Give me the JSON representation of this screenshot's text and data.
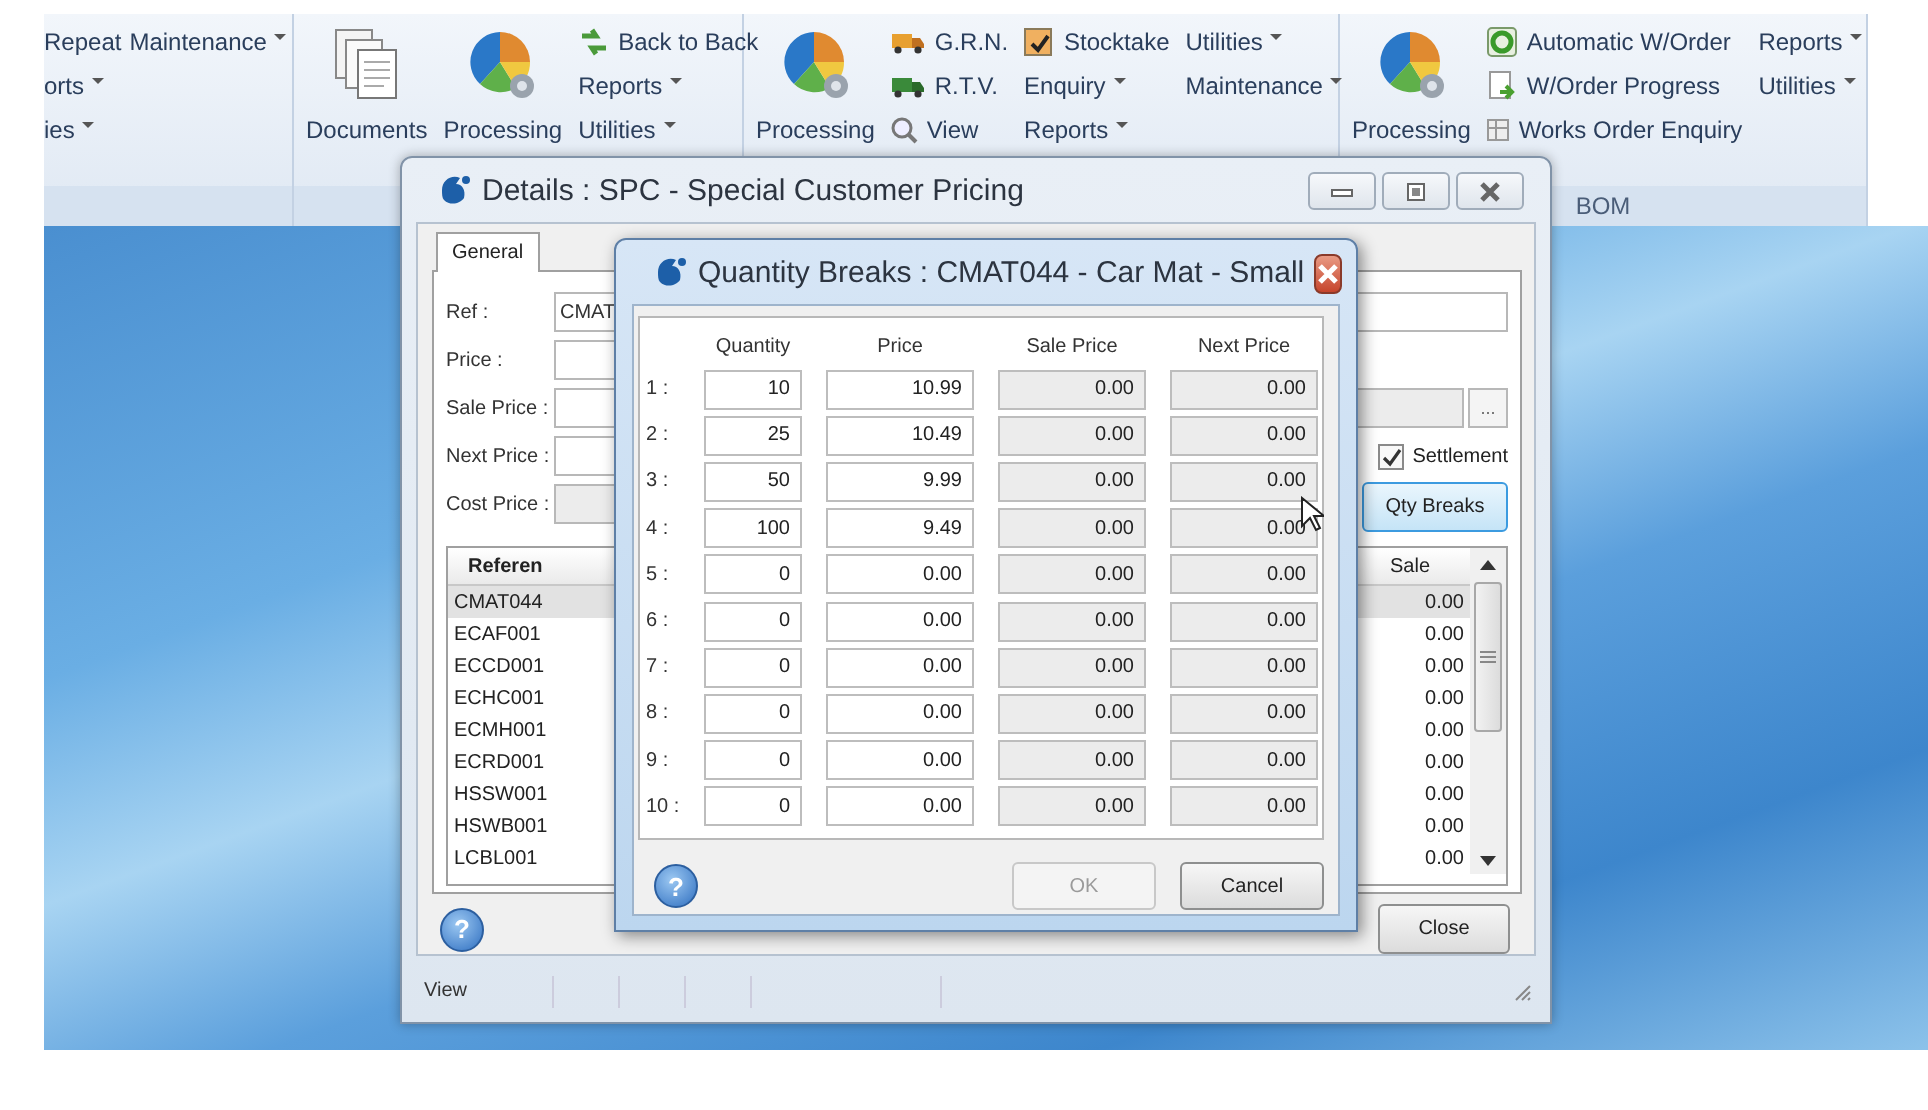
{
  "ribbon": {
    "groups": [
      {
        "columns": [
          [
            {
              "kind": "text",
              "label": "Repeat"
            },
            {
              "kind": "menu",
              "label": "orts"
            },
            {
              "kind": "menu",
              "label": "ies"
            }
          ],
          [
            {
              "kind": "menu",
              "label": "Maintenance"
            }
          ]
        ]
      },
      {
        "columns": [
          [
            {
              "kind": "large",
              "label": "Documents"
            }
          ],
          [
            {
              "kind": "large",
              "label": "Processing"
            }
          ],
          [
            {
              "kind": "small",
              "label": "Back to Back"
            },
            {
              "kind": "menu",
              "label": "Reports"
            },
            {
              "kind": "menu",
              "label": "Utilities"
            }
          ]
        ]
      },
      {
        "columns": [
          [
            {
              "kind": "large",
              "label": "Processing"
            }
          ],
          [
            {
              "kind": "small",
              "label": "G.R.N."
            },
            {
              "kind": "small",
              "label": "R.T.V."
            },
            {
              "kind": "small",
              "label": "View"
            }
          ],
          [
            {
              "kind": "check",
              "label": "Stocktake",
              "checked": true
            },
            {
              "kind": "menu",
              "label": "Enquiry"
            },
            {
              "kind": "menu",
              "label": "Reports"
            }
          ],
          [
            {
              "kind": "menu",
              "label": "Utilities"
            },
            {
              "kind": "menu",
              "label": "Maintenance"
            }
          ]
        ]
      },
      {
        "label": "BOM",
        "columns": [
          [
            {
              "kind": "large",
              "label": "Processing"
            }
          ],
          [
            {
              "kind": "small",
              "label": "Automatic W/Order"
            },
            {
              "kind": "small",
              "label": "W/Order Progress"
            },
            {
              "kind": "small",
              "label": "Works Order Enquiry"
            }
          ],
          [
            {
              "kind": "menu",
              "label": "Reports"
            },
            {
              "kind": "menu",
              "label": "Utilities"
            }
          ]
        ]
      }
    ]
  },
  "details": {
    "title": "Details : SPC - Special Customer Pricing",
    "tabs": [
      {
        "label": "General",
        "selected": true
      }
    ],
    "fields": [
      {
        "label": "Ref :",
        "value": "CMAT",
        "disabled": false
      },
      {
        "label": "Price :",
        "disabled": false
      },
      {
        "label": "Sale Price :",
        "disabled": false
      },
      {
        "label": "Next Price :",
        "disabled": false
      },
      {
        "label": "Cost Price :",
        "disabled": true
      }
    ],
    "lookup_button": "...",
    "settlement": {
      "label": "Settlement",
      "checked": true
    },
    "qty_breaks_button": "Qty Breaks",
    "table": {
      "columns": [
        "Referen",
        "Sale"
      ],
      "rows": [
        {
          "reference": "CMAT044",
          "sale": "0.00",
          "selected": true
        },
        {
          "reference": "ECAF001",
          "sale": "0.00",
          "selected": false
        },
        {
          "reference": "ECCD001",
          "sale": "0.00",
          "selected": false
        },
        {
          "reference": "ECHC001",
          "sale": "0.00",
          "selected": false
        },
        {
          "reference": "ECMH001",
          "sale": "0.00",
          "selected": false
        },
        {
          "reference": "ECRD001",
          "sale": "0.00",
          "selected": false
        },
        {
          "reference": "HSSW001",
          "sale": "0.00",
          "selected": false
        },
        {
          "reference": "HSWB001",
          "sale": "0.00",
          "selected": false
        },
        {
          "reference": "LCBL001",
          "sale": "0.00",
          "selected": false
        }
      ]
    },
    "help_button": "?",
    "close_button": "Close",
    "status_bar": [
      "View"
    ]
  },
  "dialog": {
    "title": "Quantity Breaks : CMAT044 - Car Mat - Small",
    "columns": [
      {
        "label": "Quantity",
        "disabled": false
      },
      {
        "label": "Price",
        "disabled": false
      },
      {
        "label": "Sale Price",
        "disabled": true
      },
      {
        "label": "Next Price",
        "disabled": true
      }
    ],
    "rows": [
      {
        "number": "1 :",
        "values": [
          "10",
          "10.99",
          "0.00",
          "0.00"
        ]
      },
      {
        "number": "2 :",
        "values": [
          "25",
          "10.49",
          "0.00",
          "0.00"
        ]
      },
      {
        "number": "3 :",
        "values": [
          "50",
          "9.99",
          "0.00",
          "0.00"
        ]
      },
      {
        "number": "4 :",
        "values": [
          "100",
          "9.49",
          "0.00",
          "0.00"
        ]
      },
      {
        "number": "5 :",
        "values": [
          "0",
          "0.00",
          "0.00",
          "0.00"
        ]
      },
      {
        "number": "6 :",
        "values": [
          "0",
          "0.00",
          "0.00",
          "0.00"
        ]
      },
      {
        "number": "7 :",
        "values": [
          "0",
          "0.00",
          "0.00",
          "0.00"
        ]
      },
      {
        "number": "8 :",
        "values": [
          "0",
          "0.00",
          "0.00",
          "0.00"
        ]
      },
      {
        "number": "9 :",
        "values": [
          "0",
          "0.00",
          "0.00",
          "0.00"
        ]
      },
      {
        "number": "10 :",
        "values": [
          "0",
          "0.00",
          "0.00",
          "0.00"
        ]
      }
    ],
    "help_button": "?",
    "ok_button": {
      "label": "OK",
      "disabled": true
    },
    "cancel_button": {
      "label": "Cancel",
      "disabled": false
    }
  }
}
